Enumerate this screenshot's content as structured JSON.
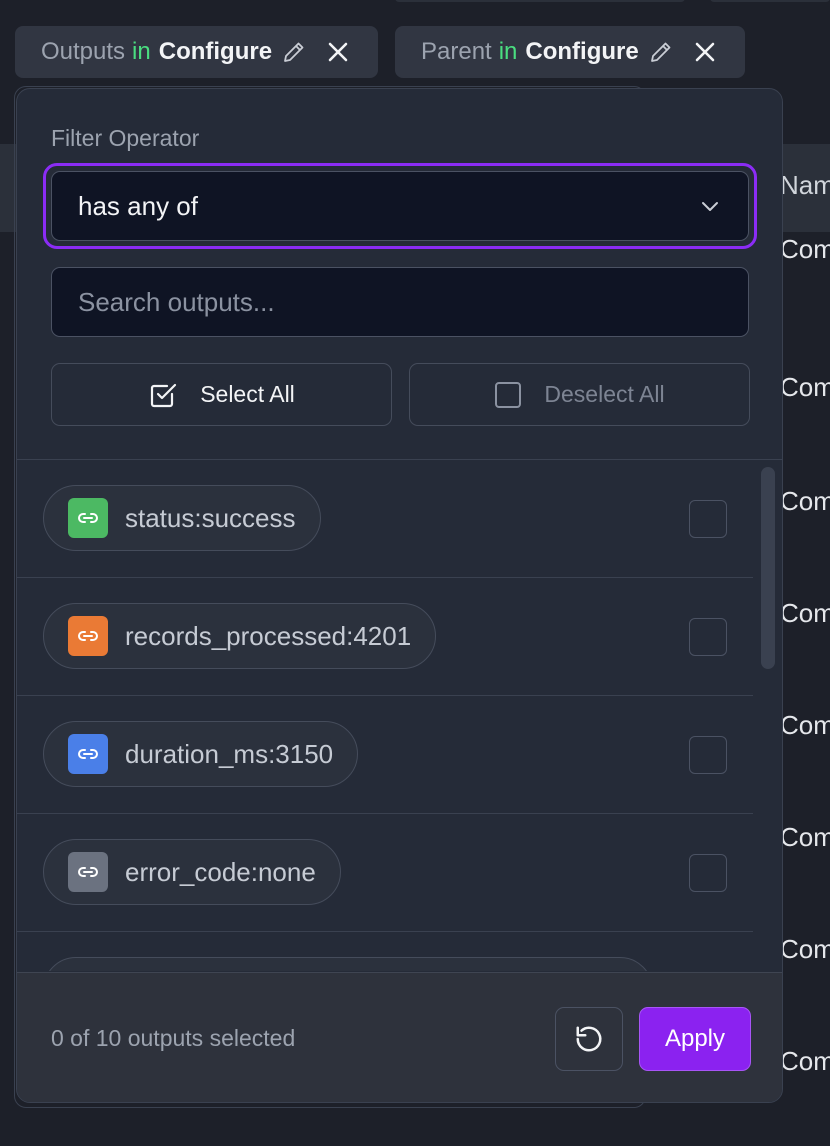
{
  "background": {
    "column_header": "Name",
    "cells": [
      "Comp",
      "Comp",
      "Comp",
      "Comp",
      "Comp",
      "Comp",
      "Comp",
      "Comp"
    ]
  },
  "chips": [
    {
      "field": "Outputs",
      "in": "in",
      "target": "Configure"
    },
    {
      "field": "Parent",
      "in": "in",
      "target": "Configure"
    }
  ],
  "popover": {
    "label": "Filter Operator",
    "operator": {
      "selected": "has any of"
    },
    "search": {
      "placeholder": "Search outputs..."
    },
    "select_all": "Select All",
    "deselect_all": "Deselect All",
    "items": [
      {
        "label": "status:success",
        "color": "#4cb963"
      },
      {
        "label": "records_processed:4201",
        "color": "#ea7a35"
      },
      {
        "label": "duration_ms:3150",
        "color": "#4a7fe8"
      },
      {
        "label": "error_code:none",
        "color": "#6b7280"
      }
    ],
    "footer": {
      "count_text": "0 of 10 outputs selected",
      "apply": "Apply"
    }
  },
  "colors": {
    "accent": "#8b22f0",
    "focus_ring": "#8b2cf5",
    "in_keyword": "#4ade80"
  }
}
